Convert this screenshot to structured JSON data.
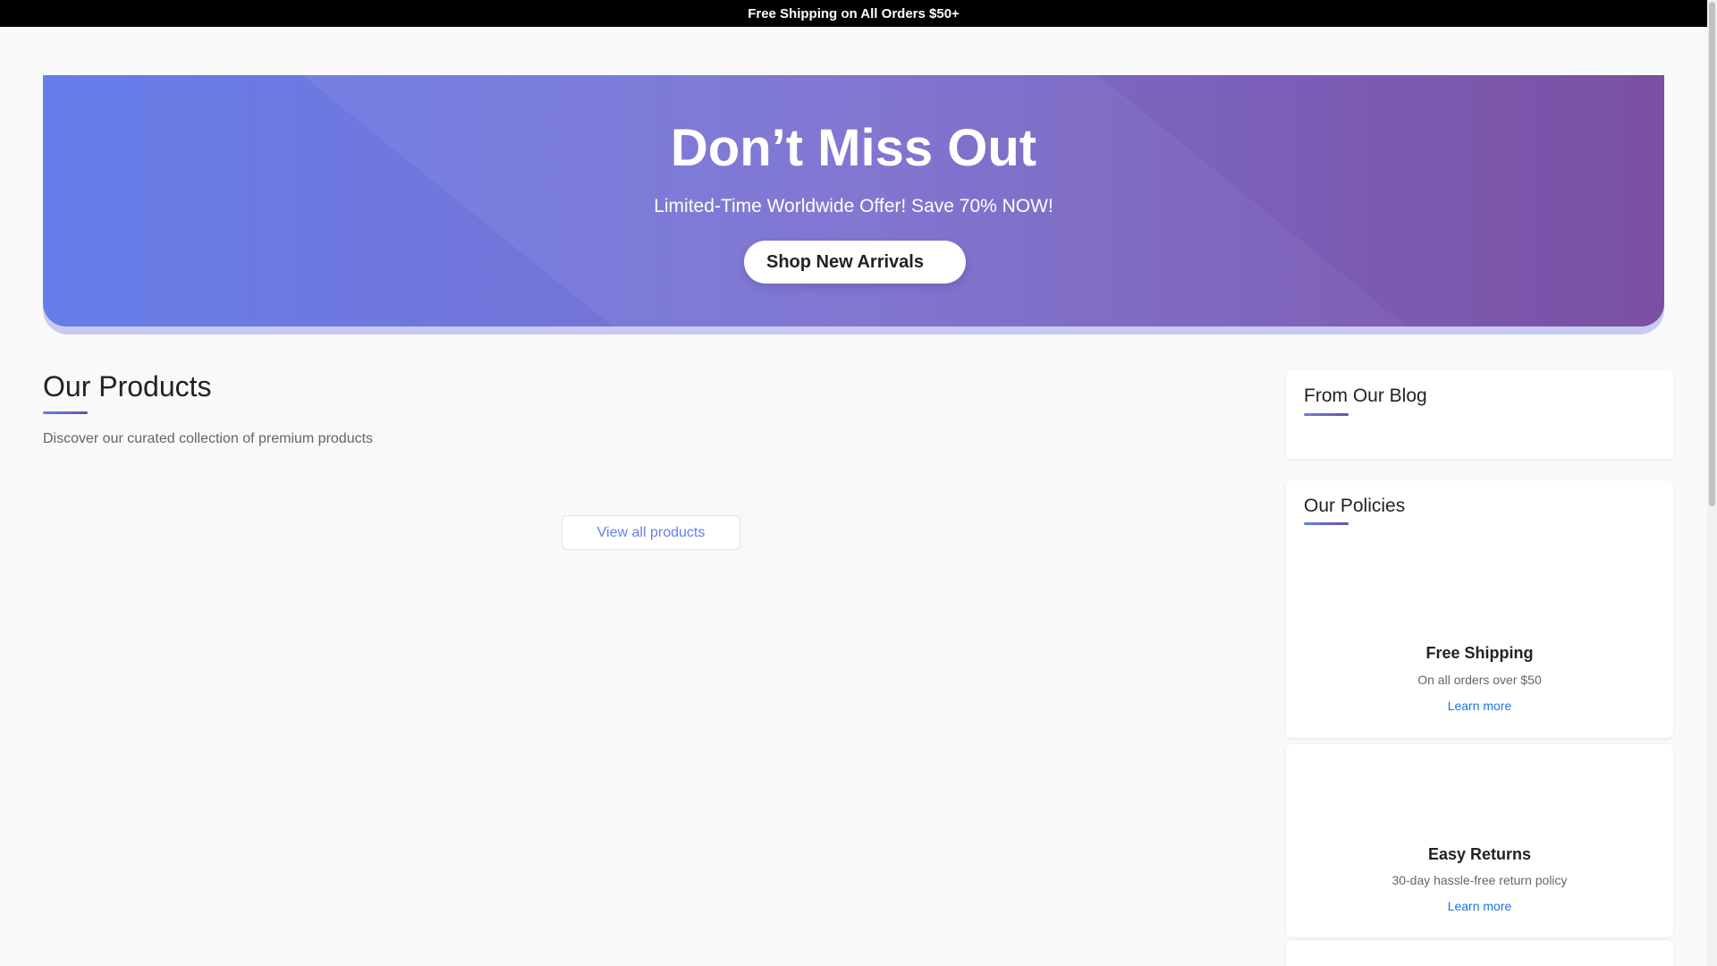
{
  "announcement": "Free Shipping on All Orders $50+",
  "hero": {
    "title": "Don’t Miss Out",
    "subtitle": "Limited-Time Worldwide Offer! Save 70% NOW!",
    "cta_label": "Shop New Arrivals"
  },
  "products": {
    "title": "Our Products",
    "subtitle": "Discover our curated collection of premium products",
    "view_all_label": "View all products"
  },
  "sidebar": {
    "blog_title": "From Our Blog",
    "policies_title": "Our Policies",
    "policies": [
      {
        "name": "Free Shipping",
        "description": "On all orders over $50",
        "link_label": "Learn more"
      },
      {
        "name": "Easy Returns",
        "description": "30-day hassle-free return policy",
        "link_label": "Learn more"
      }
    ]
  },
  "colors": {
    "gradient_start": "#667eea",
    "gradient_end": "#764ba2",
    "link": "#1a73e8",
    "announcement_bg": "#000000"
  }
}
